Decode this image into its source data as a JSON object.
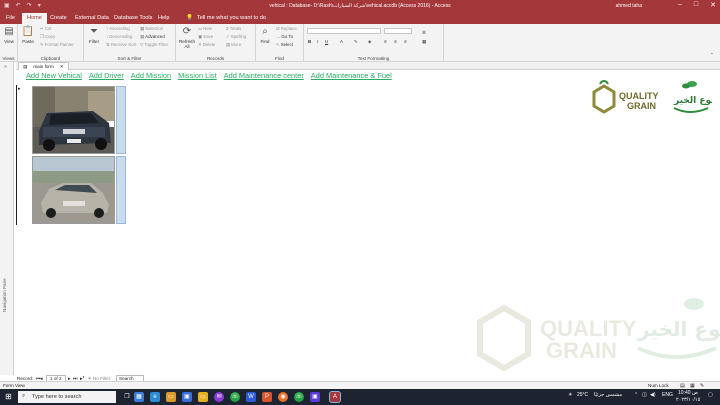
{
  "titlebar": {
    "title": "vehical : Database- D:\\Rash\\شركة السيارات\\vehical.accdb (Access 2016) - Access",
    "user": "ahmed taha"
  },
  "ribbon_tabs": [
    "File",
    "Home",
    "Create",
    "External Data",
    "Database Tools",
    "Help"
  ],
  "tell_me": "Tell me what you want to do",
  "ribbon": {
    "views": {
      "view": "View",
      "label": "Views"
    },
    "clipboard": {
      "paste": "Paste",
      "cut": "Cut",
      "copy": "Copy",
      "format_painter": "Format Painter",
      "label": "Clipboard"
    },
    "sort_filter": {
      "filter": "Filter",
      "ascending": "Ascending",
      "descending": "Descending",
      "remove_sort": "Remove Sort",
      "selection": "Selection",
      "advanced": "Advanced",
      "toggle_filter": "Toggle Filter",
      "label": "Sort & Filter"
    },
    "records": {
      "refresh": "Refresh",
      "refresh_all": "All",
      "new": "New",
      "save": "Save",
      "delete": "Delete",
      "totals": "Totals",
      "spelling": "Spelling",
      "more": "More",
      "label": "Records"
    },
    "find": {
      "find": "Find",
      "replace": "Replace",
      "goto": "Go To",
      "select": "Select",
      "label": "Find"
    },
    "text_formatting": {
      "label": "Text Formatting"
    }
  },
  "navigation_pane_label": "Navigation Pane",
  "doc_tab": "main form",
  "nav_links": [
    "Add New Vehical",
    "Add Driver",
    "Add Mission",
    "Mission List",
    "Add Maintenance center",
    "Add Maintenance & Fuel"
  ],
  "logo": {
    "quality": "QUALITY",
    "grain": "GRAIN",
    "arabic": "ربوع الخير"
  },
  "record_nav": {
    "label": "Record:",
    "position": "1 of 2",
    "no_filter": "No Filter",
    "search": "Search"
  },
  "status": {
    "view": "Form View",
    "num_lock": "Num Lock"
  },
  "taskbar": {
    "search": "Type here to search",
    "weather": "25°C",
    "weather_text": "مشمس جزئيًا",
    "lang": "ENG",
    "time": "10:40 ص",
    "date": "٢٠٢٣/١٠/١٥"
  },
  "colors": {
    "accent": "#a4373a",
    "link": "#27ae60"
  }
}
